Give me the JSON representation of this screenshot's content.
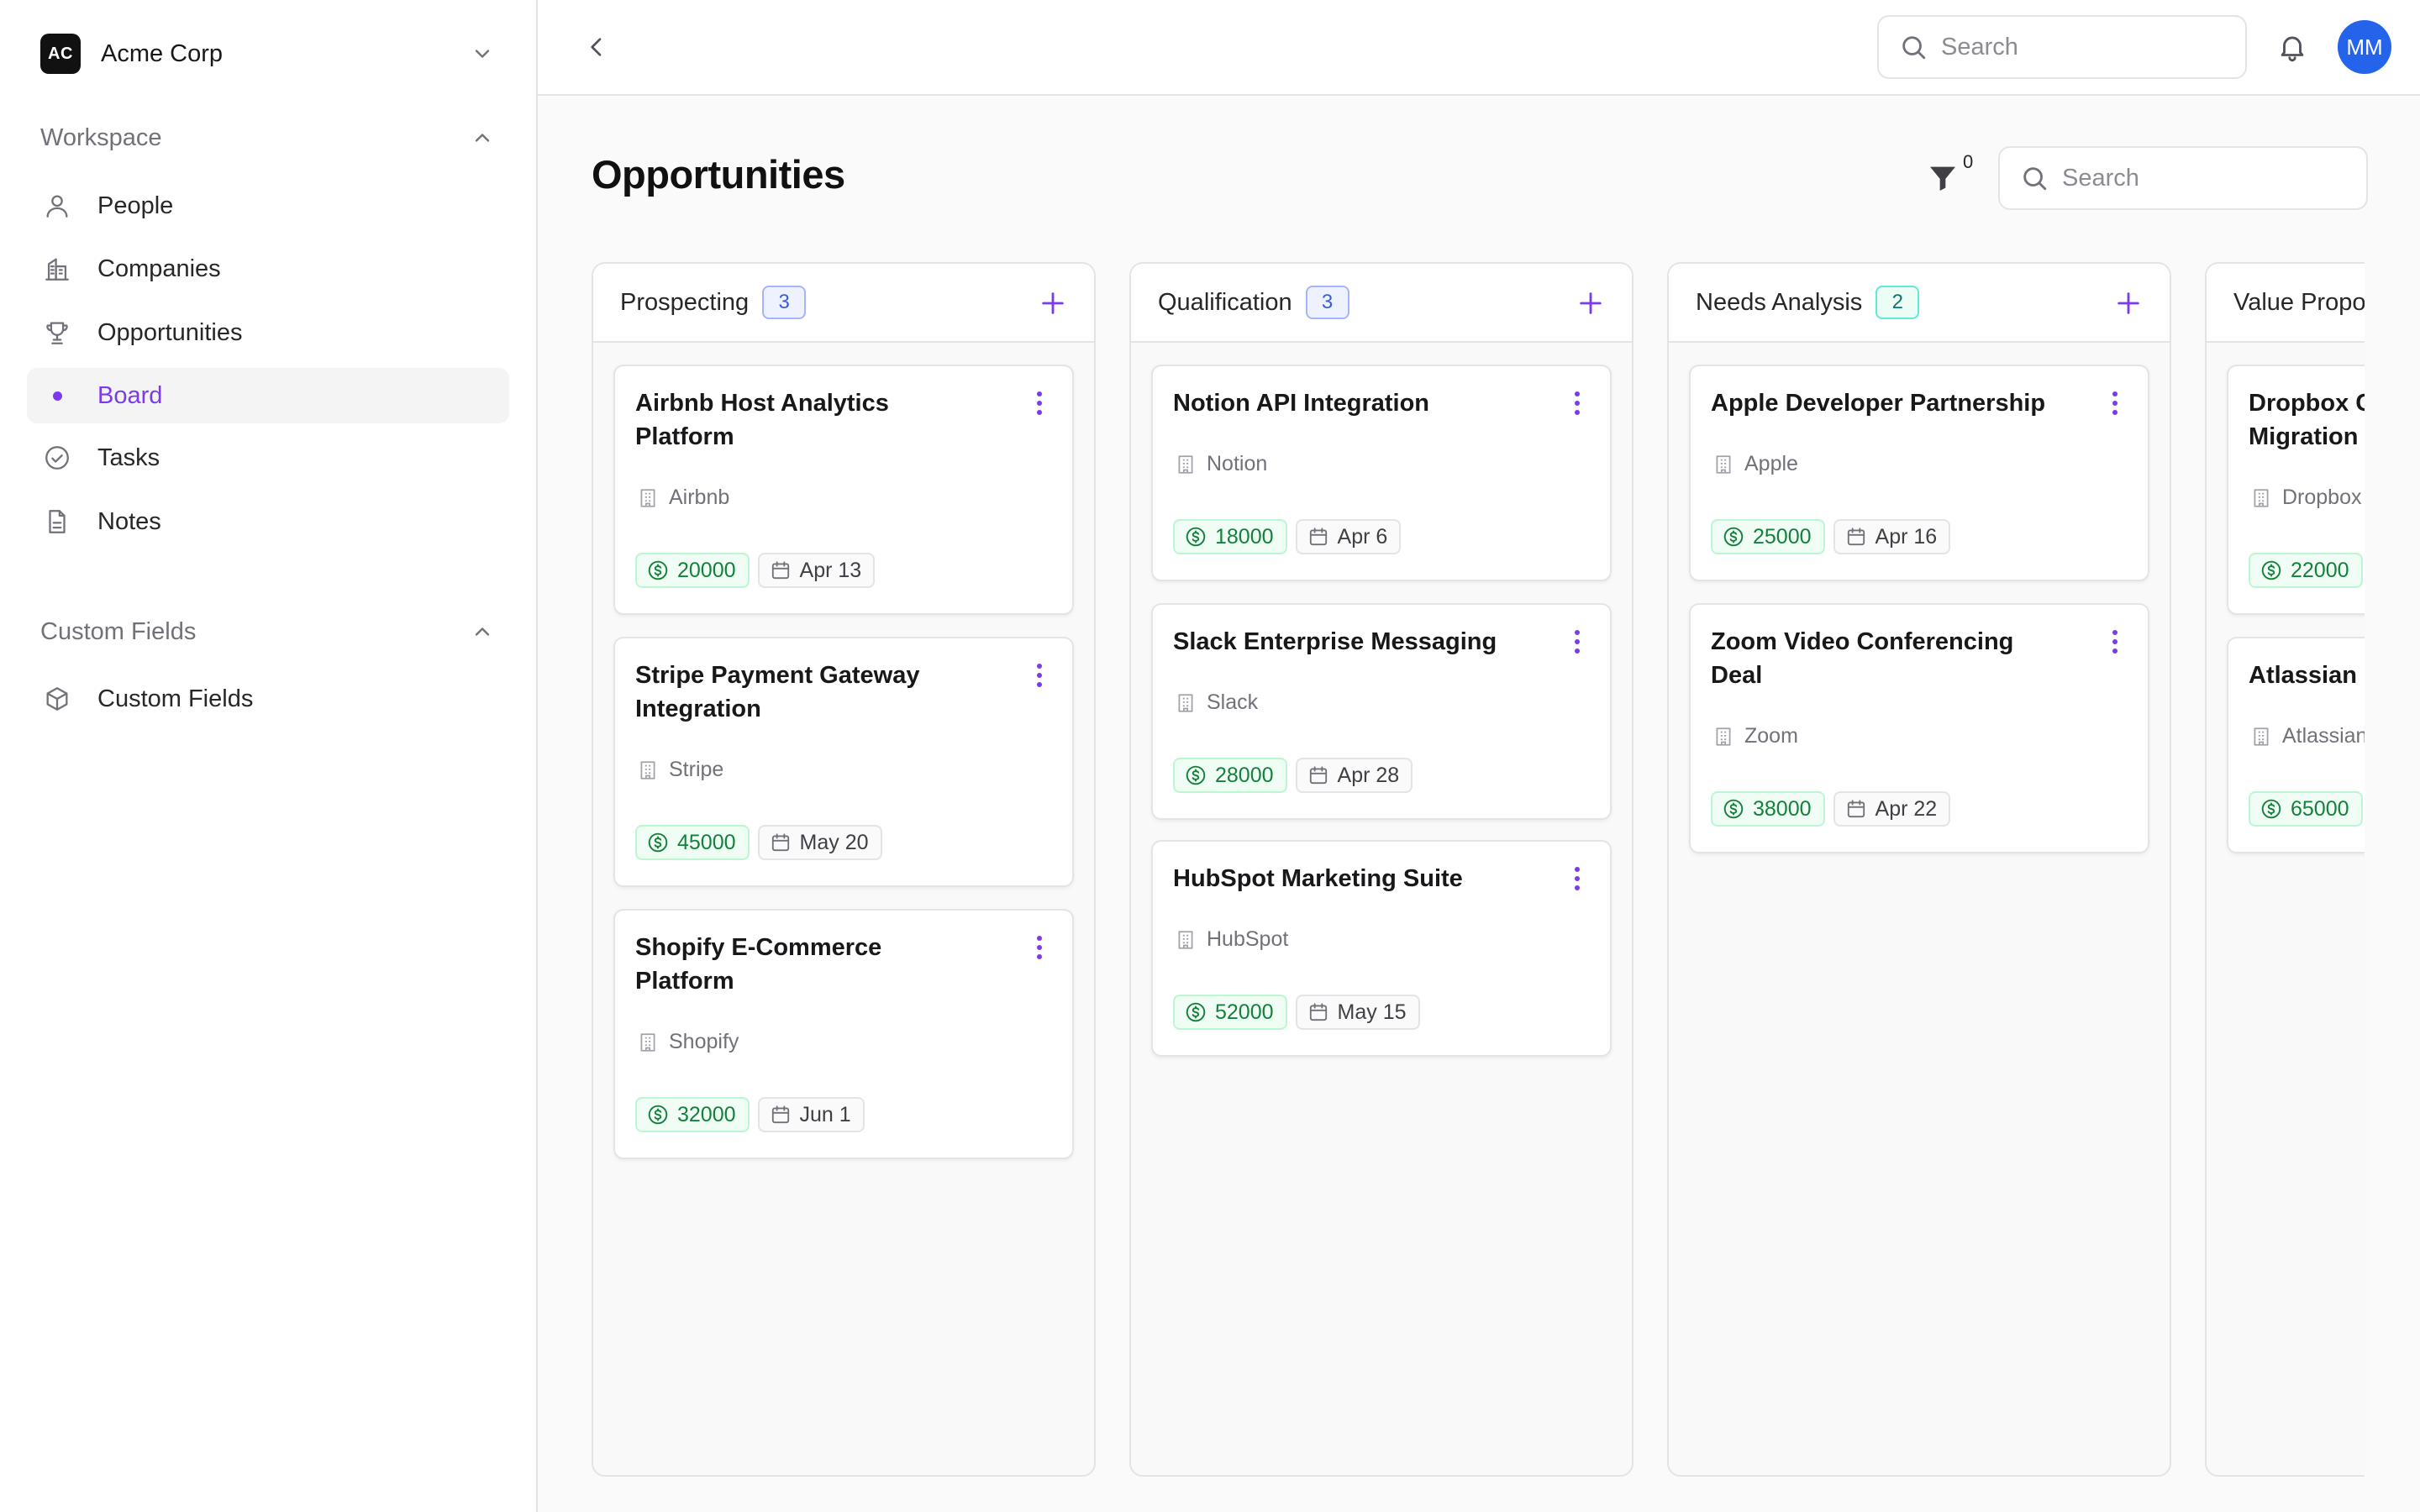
{
  "sidebar": {
    "org": {
      "logo": "AC",
      "name": "Acme Corp"
    },
    "workspace_title": "Workspace",
    "items": [
      {
        "label": "People",
        "icon": "person-icon"
      },
      {
        "label": "Companies",
        "icon": "building-icon"
      },
      {
        "label": "Opportunities",
        "icon": "trophy-icon"
      },
      {
        "label": "Board",
        "icon": "dot-icon",
        "active": true
      },
      {
        "label": "Tasks",
        "icon": "check-circle-icon"
      },
      {
        "label": "Notes",
        "icon": "document-icon"
      }
    ],
    "custom_fields_title": "Custom Fields",
    "custom_items": [
      {
        "label": "Custom Fields",
        "icon": "cube-icon"
      }
    ]
  },
  "topbar": {
    "search_placeholder": "Search",
    "avatar_initials": "MM",
    "avatar_color": "#2563eb"
  },
  "page": {
    "title": "Opportunities",
    "filter_count": "0",
    "search_placeholder": "Search"
  },
  "accent_color": "#7c3aed",
  "columns": [
    {
      "title": "Prospecting",
      "count": "3",
      "cards": [
        {
          "title": "Airbnb Host Analytics Platform",
          "company": "Airbnb",
          "amount": "20000",
          "date": "Apr 13"
        },
        {
          "title": "Stripe Payment Gateway Integration",
          "company": "Stripe",
          "amount": "45000",
          "date": "May 20"
        },
        {
          "title": "Shopify E-Commerce Platform",
          "company": "Shopify",
          "amount": "32000",
          "date": "Jun 1"
        }
      ]
    },
    {
      "title": "Qualification",
      "count": "3",
      "cards": [
        {
          "title": "Notion API Integration",
          "company": "Notion",
          "amount": "18000",
          "date": "Apr 6"
        },
        {
          "title": "Slack Enterprise Messaging",
          "company": "Slack",
          "amount": "28000",
          "date": "Apr 28"
        },
        {
          "title": "HubSpot Marketing Suite",
          "company": "HubSpot",
          "amount": "52000",
          "date": "May 15"
        }
      ]
    },
    {
      "title": "Needs Analysis",
      "count": "2",
      "cards": [
        {
          "title": "Apple Developer Partnership",
          "company": "Apple",
          "amount": "25000",
          "date": "Apr 16"
        },
        {
          "title": "Zoom Video Conferencing Deal",
          "company": "Zoom",
          "amount": "38000",
          "date": "Apr 22"
        }
      ]
    },
    {
      "title": "Value Propo",
      "cards": [
        {
          "title": "Dropbox C\nMigration",
          "company": "Dropbox",
          "amount": "22000"
        },
        {
          "title": "Atlassian D",
          "company": "Atlassian",
          "amount": "65000"
        }
      ]
    }
  ]
}
